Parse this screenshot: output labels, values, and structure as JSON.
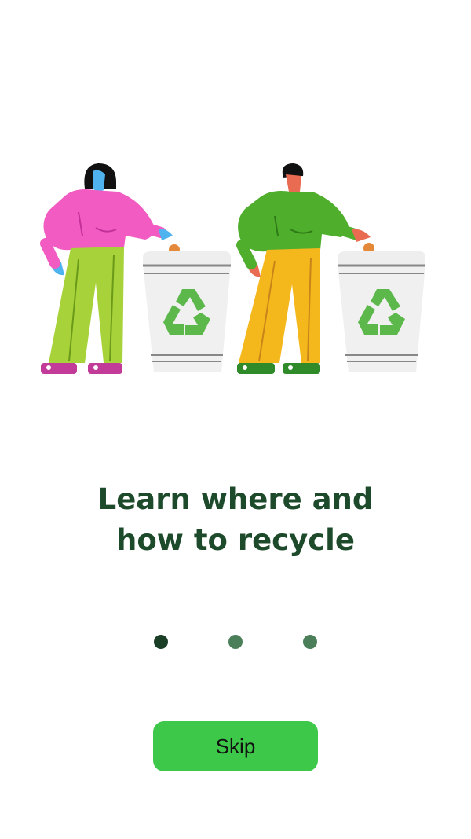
{
  "onboarding": {
    "illustration": "people-recycling-bins",
    "headline_line1": "Learn where and",
    "headline_line2": "how to recycle",
    "page_count": 3,
    "active_page": 1,
    "skip_label": "Skip"
  },
  "colors": {
    "headline": "#1c4a2a",
    "dot_active": "#1b3e27",
    "dot_inactive": "#4b7f5a",
    "skip_button": "#3ec84a",
    "recycle_symbol": "#5cb84a"
  }
}
